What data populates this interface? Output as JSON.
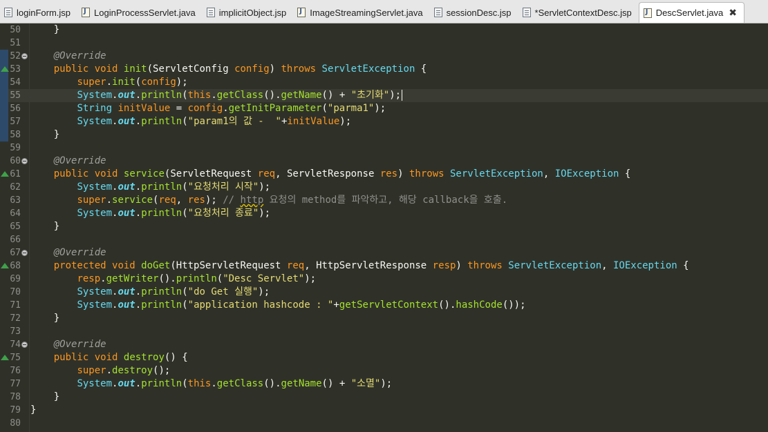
{
  "tabs": [
    {
      "label": "loginForm.jsp",
      "type": "jsp"
    },
    {
      "label": "LoginProcessServlet.java",
      "type": "java"
    },
    {
      "label": "implicitObject.jsp",
      "type": "jsp"
    },
    {
      "label": "ImageStreamingServlet.java",
      "type": "java"
    },
    {
      "label": "sessionDesc.jsp",
      "type": "jsp"
    },
    {
      "label": "*ServletContextDesc.jsp",
      "type": "jsp"
    },
    {
      "label": "DescServlet.java",
      "type": "java",
      "active": true,
      "close": "✖"
    }
  ],
  "lines": [
    {
      "n": "50",
      "tokens": [
        [
          "pl",
          "    }"
        ]
      ]
    },
    {
      "n": "51",
      "tokens": []
    },
    {
      "n": "52",
      "fold": true,
      "mark": true,
      "tokens": [
        [
          "an",
          "    @Override"
        ]
      ]
    },
    {
      "n": "53",
      "ovr": true,
      "mark": true,
      "tokens": [
        [
          "pl",
          "    "
        ],
        [
          "kw2",
          "public"
        ],
        [
          "pl",
          " "
        ],
        [
          "kw2",
          "void"
        ],
        [
          "pl",
          " "
        ],
        [
          "fn",
          "init"
        ],
        [
          "pl",
          "("
        ],
        [
          "pl",
          "ServletConfig"
        ],
        [
          "pl",
          " "
        ],
        [
          "var",
          "config"
        ],
        [
          "pl",
          ") "
        ],
        [
          "kw2",
          "throws"
        ],
        [
          "pl",
          " "
        ],
        [
          "ty",
          "ServletException"
        ],
        [
          "pl",
          " {"
        ]
      ]
    },
    {
      "n": "54",
      "mark": true,
      "tokens": [
        [
          "pl",
          "        "
        ],
        [
          "kw2",
          "super"
        ],
        [
          "pl",
          "."
        ],
        [
          "fn",
          "init"
        ],
        [
          "pl",
          "("
        ],
        [
          "var",
          "config"
        ],
        [
          "pl",
          ");"
        ]
      ]
    },
    {
      "n": "55",
      "mark": true,
      "current": true,
      "caret": true,
      "tokens": [
        [
          "pl",
          "        "
        ],
        [
          "ty",
          "System"
        ],
        [
          "pl",
          "."
        ],
        [
          "fld",
          "out"
        ],
        [
          "pl",
          "."
        ],
        [
          "fn",
          "println"
        ],
        [
          "pl",
          "("
        ],
        [
          "kw2",
          "this"
        ],
        [
          "pl",
          "."
        ],
        [
          "fn",
          "getClass"
        ],
        [
          "pl",
          "()."
        ],
        [
          "fn",
          "getName"
        ],
        [
          "pl",
          "() + "
        ],
        [
          "st",
          "\"초기화\""
        ],
        [
          "pl",
          ");"
        ]
      ]
    },
    {
      "n": "56",
      "mark": true,
      "tokens": [
        [
          "pl",
          "        "
        ],
        [
          "ty",
          "String"
        ],
        [
          "pl",
          " "
        ],
        [
          "var",
          "initValue"
        ],
        [
          "pl",
          " = "
        ],
        [
          "var",
          "config"
        ],
        [
          "pl",
          "."
        ],
        [
          "fn",
          "getInitParameter"
        ],
        [
          "pl",
          "("
        ],
        [
          "st",
          "\"parma1\""
        ],
        [
          "pl",
          ");"
        ]
      ]
    },
    {
      "n": "57",
      "mark": true,
      "tokens": [
        [
          "pl",
          "        "
        ],
        [
          "ty",
          "System"
        ],
        [
          "pl",
          "."
        ],
        [
          "fld",
          "out"
        ],
        [
          "pl",
          "."
        ],
        [
          "fn",
          "println"
        ],
        [
          "pl",
          "("
        ],
        [
          "st",
          "\"param1의 값 -  \""
        ],
        [
          "pl",
          "+"
        ],
        [
          "var",
          "initValue"
        ],
        [
          "pl",
          ");"
        ]
      ]
    },
    {
      "n": "58",
      "mark": true,
      "tokens": [
        [
          "pl",
          "    }"
        ]
      ]
    },
    {
      "n": "59",
      "tokens": []
    },
    {
      "n": "60",
      "fold": true,
      "tokens": [
        [
          "an",
          "    @Override"
        ]
      ]
    },
    {
      "n": "61",
      "ovr": true,
      "tokens": [
        [
          "pl",
          "    "
        ],
        [
          "kw2",
          "public"
        ],
        [
          "pl",
          " "
        ],
        [
          "kw2",
          "void"
        ],
        [
          "pl",
          " "
        ],
        [
          "fn",
          "service"
        ],
        [
          "pl",
          "("
        ],
        [
          "pl",
          "ServletRequest"
        ],
        [
          "pl",
          " "
        ],
        [
          "var",
          "req"
        ],
        [
          "pl",
          ", "
        ],
        [
          "pl",
          "ServletResponse"
        ],
        [
          "pl",
          " "
        ],
        [
          "var",
          "res"
        ],
        [
          "pl",
          ") "
        ],
        [
          "kw2",
          "throws"
        ],
        [
          "pl",
          " "
        ],
        [
          "ty",
          "ServletException"
        ],
        [
          "pl",
          ", "
        ],
        [
          "ty",
          "IOException"
        ],
        [
          "pl",
          " {"
        ]
      ]
    },
    {
      "n": "62",
      "tokens": [
        [
          "pl",
          "        "
        ],
        [
          "ty",
          "System"
        ],
        [
          "pl",
          "."
        ],
        [
          "fld",
          "out"
        ],
        [
          "pl",
          "."
        ],
        [
          "fn",
          "println"
        ],
        [
          "pl",
          "("
        ],
        [
          "st",
          "\"요청처리 시작\""
        ],
        [
          "pl",
          ");"
        ]
      ]
    },
    {
      "n": "63",
      "tokens": [
        [
          "pl",
          "        "
        ],
        [
          "kw2",
          "super"
        ],
        [
          "pl",
          "."
        ],
        [
          "fn",
          "service"
        ],
        [
          "pl",
          "("
        ],
        [
          "var",
          "req"
        ],
        [
          "pl",
          ", "
        ],
        [
          "var",
          "res"
        ],
        [
          "pl",
          "); "
        ],
        [
          "cm",
          "// "
        ],
        [
          "cmw",
          "http"
        ],
        [
          "cm",
          " 요청의 method를 파악하고, 해당 callback을 호출."
        ]
      ]
    },
    {
      "n": "64",
      "tokens": [
        [
          "pl",
          "        "
        ],
        [
          "ty",
          "System"
        ],
        [
          "pl",
          "."
        ],
        [
          "fld",
          "out"
        ],
        [
          "pl",
          "."
        ],
        [
          "fn",
          "println"
        ],
        [
          "pl",
          "("
        ],
        [
          "st",
          "\"요청처리 종료\""
        ],
        [
          "pl",
          ");"
        ]
      ]
    },
    {
      "n": "65",
      "tokens": [
        [
          "pl",
          "    }"
        ]
      ]
    },
    {
      "n": "66",
      "tokens": []
    },
    {
      "n": "67",
      "fold": true,
      "tokens": [
        [
          "an",
          "    @Override"
        ]
      ]
    },
    {
      "n": "68",
      "ovr": true,
      "tokens": [
        [
          "pl",
          "    "
        ],
        [
          "kw2",
          "protected"
        ],
        [
          "pl",
          " "
        ],
        [
          "kw2",
          "void"
        ],
        [
          "pl",
          " "
        ],
        [
          "fn",
          "doGet"
        ],
        [
          "pl",
          "("
        ],
        [
          "pl",
          "HttpServletRequest"
        ],
        [
          "pl",
          " "
        ],
        [
          "var",
          "req"
        ],
        [
          "pl",
          ", "
        ],
        [
          "pl",
          "HttpServletResponse"
        ],
        [
          "pl",
          " "
        ],
        [
          "var",
          "resp"
        ],
        [
          "pl",
          ") "
        ],
        [
          "kw2",
          "throws"
        ],
        [
          "pl",
          " "
        ],
        [
          "ty",
          "ServletException"
        ],
        [
          "pl",
          ", "
        ],
        [
          "ty",
          "IOException"
        ],
        [
          "pl",
          " {"
        ]
      ]
    },
    {
      "n": "69",
      "tokens": [
        [
          "pl",
          "        "
        ],
        [
          "var",
          "resp"
        ],
        [
          "pl",
          "."
        ],
        [
          "fn",
          "getWriter"
        ],
        [
          "pl",
          "()."
        ],
        [
          "fn",
          "println"
        ],
        [
          "pl",
          "("
        ],
        [
          "st",
          "\"Desc Servlet\""
        ],
        [
          "pl",
          ");"
        ]
      ]
    },
    {
      "n": "70",
      "tokens": [
        [
          "pl",
          "        "
        ],
        [
          "ty",
          "System"
        ],
        [
          "pl",
          "."
        ],
        [
          "fld",
          "out"
        ],
        [
          "pl",
          "."
        ],
        [
          "fn",
          "println"
        ],
        [
          "pl",
          "("
        ],
        [
          "st",
          "\"do Get 실행\""
        ],
        [
          "pl",
          ");"
        ]
      ]
    },
    {
      "n": "71",
      "tokens": [
        [
          "pl",
          "        "
        ],
        [
          "ty",
          "System"
        ],
        [
          "pl",
          "."
        ],
        [
          "fld",
          "out"
        ],
        [
          "pl",
          "."
        ],
        [
          "fn",
          "println"
        ],
        [
          "pl",
          "("
        ],
        [
          "st",
          "\"application hashcode : \""
        ],
        [
          "pl",
          "+"
        ],
        [
          "fn",
          "getServletContext"
        ],
        [
          "pl",
          "()."
        ],
        [
          "fn",
          "hashCode"
        ],
        [
          "pl",
          "());"
        ]
      ]
    },
    {
      "n": "72",
      "tokens": [
        [
          "pl",
          "    }"
        ]
      ]
    },
    {
      "n": "73",
      "tokens": []
    },
    {
      "n": "74",
      "fold": true,
      "tokens": [
        [
          "an",
          "    @Override"
        ]
      ]
    },
    {
      "n": "75",
      "ovr": true,
      "tokens": [
        [
          "pl",
          "    "
        ],
        [
          "kw2",
          "public"
        ],
        [
          "pl",
          " "
        ],
        [
          "kw2",
          "void"
        ],
        [
          "pl",
          " "
        ],
        [
          "fn",
          "destroy"
        ],
        [
          "pl",
          "() {"
        ]
      ]
    },
    {
      "n": "76",
      "tokens": [
        [
          "pl",
          "        "
        ],
        [
          "kw2",
          "super"
        ],
        [
          "pl",
          "."
        ],
        [
          "fn",
          "destroy"
        ],
        [
          "pl",
          "();"
        ]
      ]
    },
    {
      "n": "77",
      "tokens": [
        [
          "pl",
          "        "
        ],
        [
          "ty",
          "System"
        ],
        [
          "pl",
          "."
        ],
        [
          "fld",
          "out"
        ],
        [
          "pl",
          "."
        ],
        [
          "fn",
          "println"
        ],
        [
          "pl",
          "("
        ],
        [
          "kw2",
          "this"
        ],
        [
          "pl",
          "."
        ],
        [
          "fn",
          "getClass"
        ],
        [
          "pl",
          "()."
        ],
        [
          "fn",
          "getName"
        ],
        [
          "pl",
          "() + "
        ],
        [
          "st",
          "\"소멸\""
        ],
        [
          "pl",
          ");"
        ]
      ]
    },
    {
      "n": "78",
      "tokens": [
        [
          "pl",
          "    }"
        ]
      ]
    },
    {
      "n": "79",
      "tokens": [
        [
          "pl",
          "}"
        ]
      ]
    },
    {
      "n": "80",
      "tokens": []
    }
  ],
  "colors": {
    "editor_bg": "#2f3129",
    "keyword": "#fd971f",
    "type": "#66d9ef",
    "function": "#a6e22e",
    "string": "#e6db74",
    "annotation": "#a0a09a",
    "comment": "#8f908a"
  }
}
